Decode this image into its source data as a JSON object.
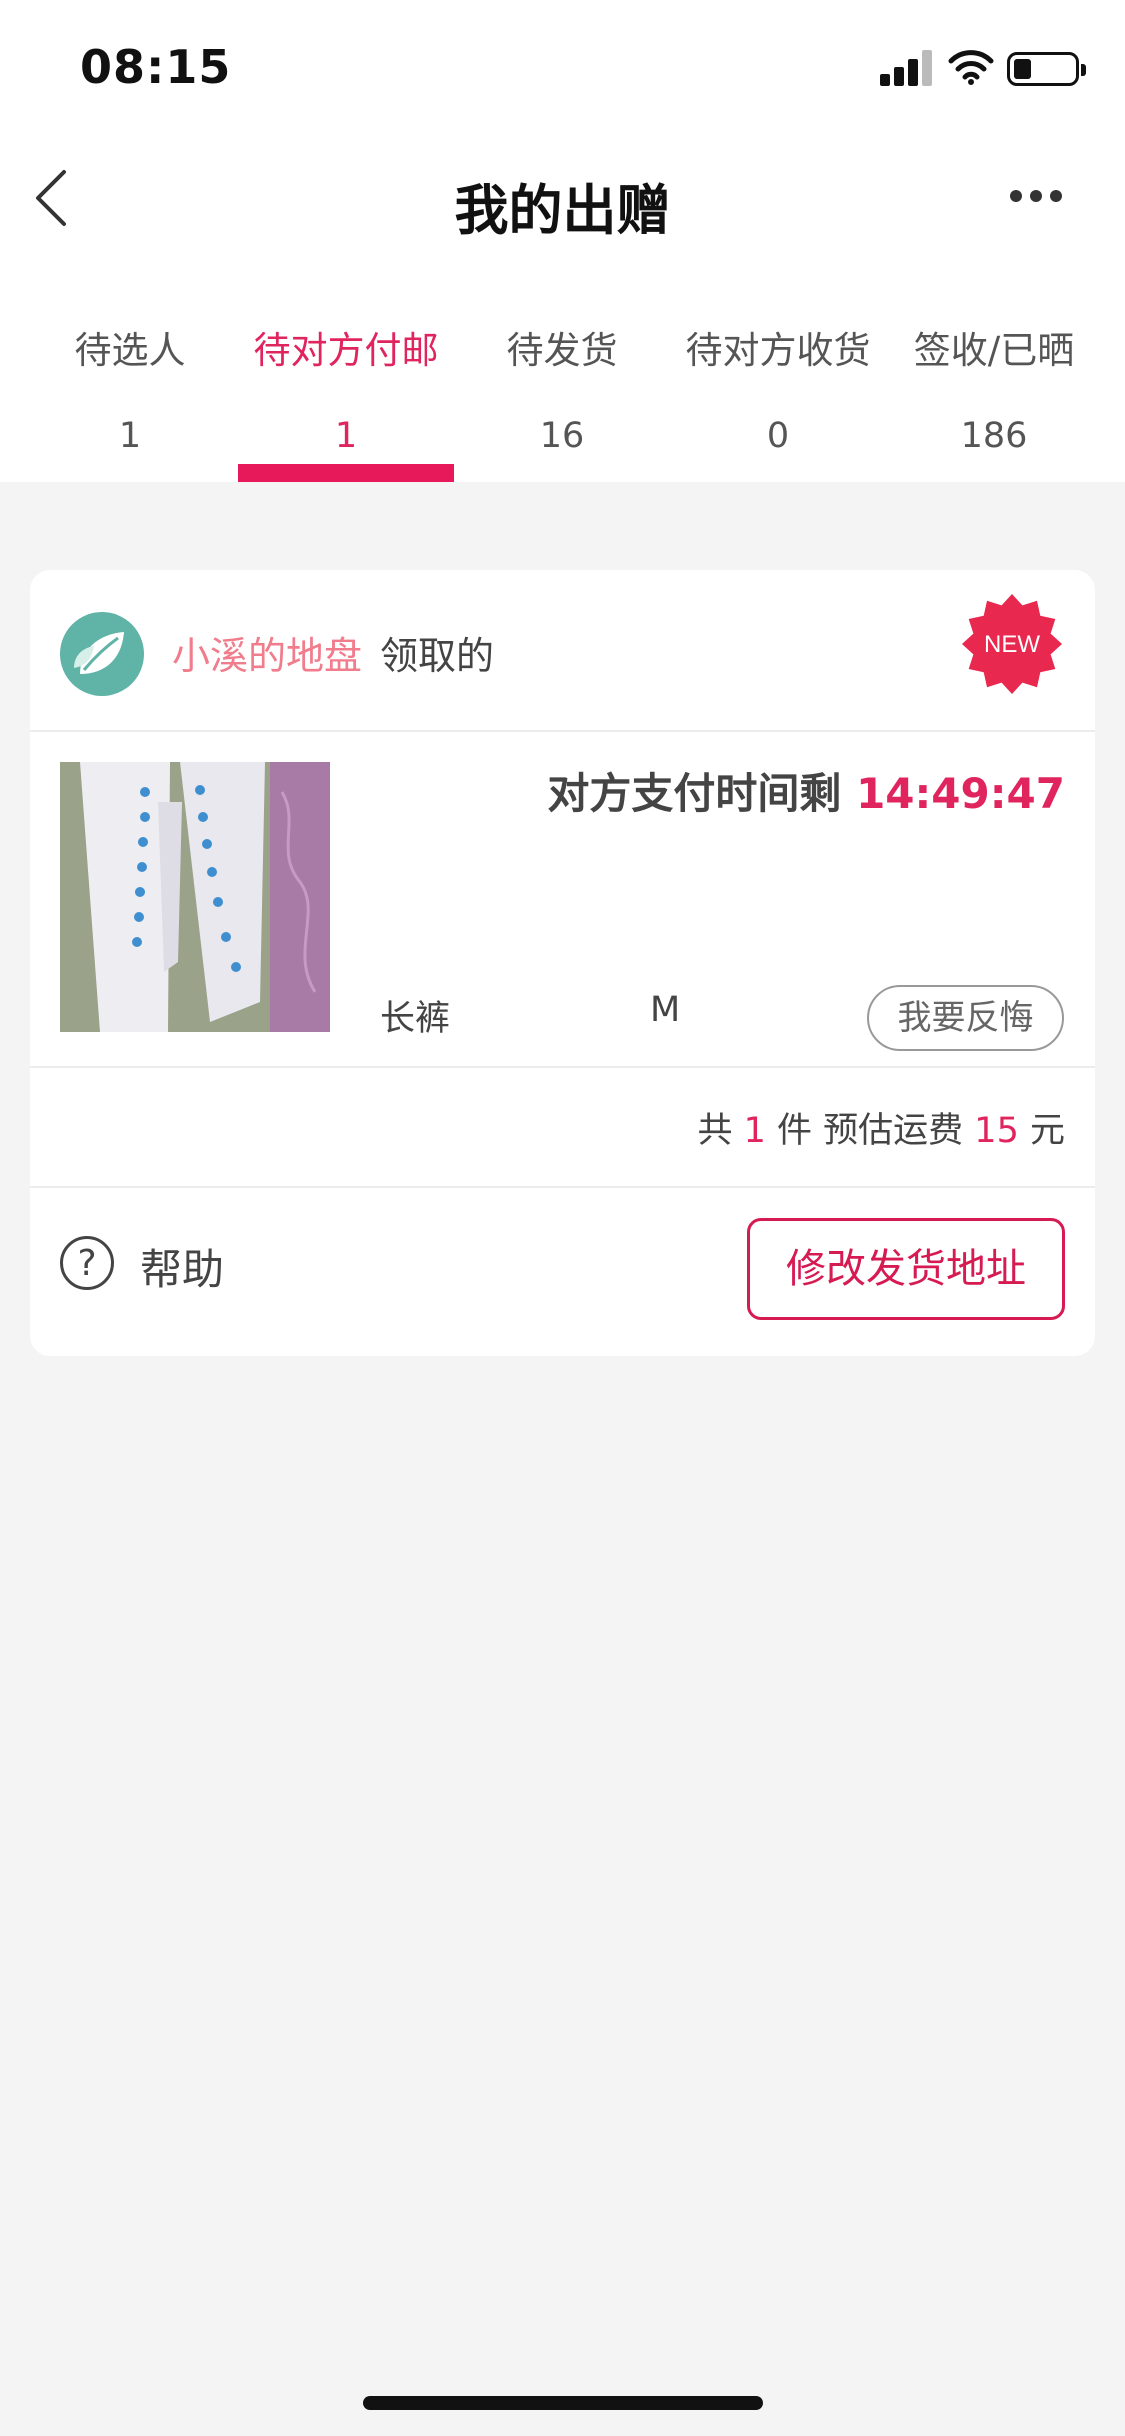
{
  "status_bar": {
    "time": "08:15"
  },
  "header": {
    "title": "我的出赠"
  },
  "tabs": [
    {
      "label": "待选人",
      "count": "1"
    },
    {
      "label": "待对方付邮",
      "count": "1"
    },
    {
      "label": "待发货",
      "count": "16"
    },
    {
      "label": "待对方收货",
      "count": "0"
    },
    {
      "label": "签收/已晒",
      "count": "186"
    }
  ],
  "active_tab": 1,
  "card": {
    "user_name": "小溪的地盘",
    "claimed_text": "领取的",
    "new_badge": "NEW",
    "countdown_label": "对方支付时间剩",
    "countdown_time": "14:49:47",
    "item_name": "长裤",
    "item_size": "M",
    "regret_button": "我要反悔",
    "summary": {
      "prefix": "共",
      "count": "1",
      "count_unit": "件 预估运费",
      "fee": "15",
      "fee_unit": "元"
    },
    "help_label": "帮助",
    "change_address_button": "修改发货地址"
  },
  "colors": {
    "accent": "#e0245e",
    "username": "#f07c8c",
    "background": "#f4f4f4"
  }
}
